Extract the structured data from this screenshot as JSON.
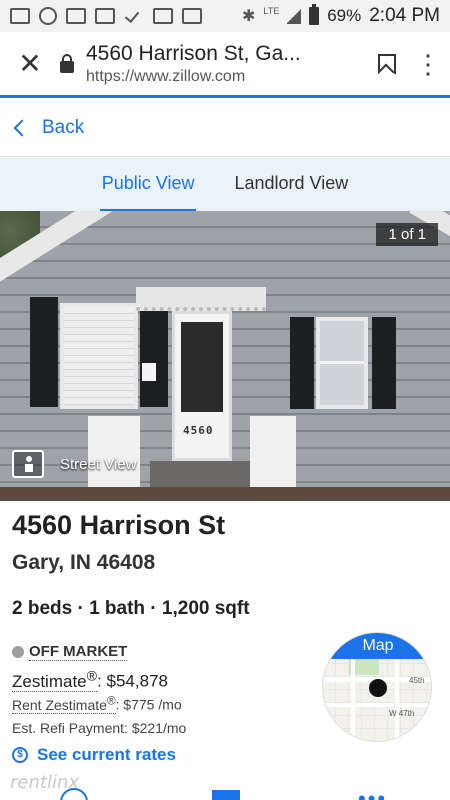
{
  "status_bar": {
    "battery": "69%",
    "network": "LTE",
    "time": "2:04 PM"
  },
  "url_bar": {
    "title": "4560 Harrison St, Ga...",
    "url": "https://www.zillow.com",
    "menu_dots": "⋮"
  },
  "back_bar": {
    "label": "Back"
  },
  "tabs": [
    {
      "label": "Public View",
      "active": true
    },
    {
      "label": "Landlord View",
      "active": false
    }
  ],
  "photo": {
    "counter": "1 of 1",
    "door_number": "4560",
    "street_view_label": "Street View"
  },
  "listing": {
    "address_line1": "4560 Harrison St",
    "address_line2": "Gary, IN 46408",
    "facts": "2 beds · 1 bath · 1,200 sqft",
    "status": "OFF MARKET",
    "zestimate_label": "Zestimate",
    "zestimate_reg": "®",
    "zestimate_value": ": $54,878",
    "rent_label": "Rent Zestimate",
    "rent_reg": "®",
    "rent_value": ": $775 /mo",
    "refi": "Est. Refi Payment: $221/mo",
    "rates_link": "See current rates",
    "rates_icon": "$"
  },
  "map": {
    "badge": "Map",
    "street_label_1": "45th",
    "street_label_2": "W 47th"
  },
  "bottom": {
    "watermark": "rentlinx",
    "more_dots": "•••"
  },
  "colors": {
    "accent": "#1a73e8",
    "tabs_bg": "#eaf2fb",
    "status_bar_bg": "#f2f2f2"
  }
}
